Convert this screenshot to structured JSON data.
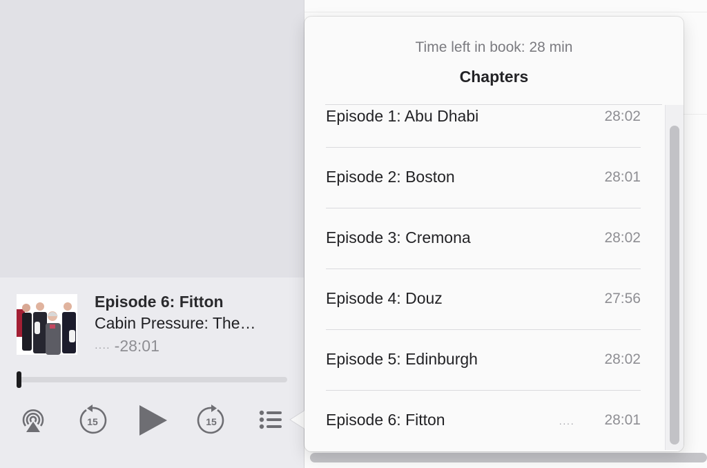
{
  "now_playing": {
    "title": "Episode 6: Fitton",
    "subtitle": "Cabin Pressure: The…",
    "remaining": "-28:01",
    "progress": 0.0
  },
  "controls": {
    "airplay_icon": "airplay-icon",
    "skip_back_seconds": "15",
    "play_icon": "play-icon",
    "skip_forward_seconds": "15",
    "chapters_icon": "list-icon"
  },
  "popover": {
    "time_left": "Time left in book: 28 min",
    "heading": "Chapters",
    "chapters": [
      {
        "title": "Episode 1: Abu Dhabi",
        "duration": "28:02"
      },
      {
        "title": "Episode 2: Boston",
        "duration": "28:01"
      },
      {
        "title": "Episode 3: Cremona",
        "duration": "28:02"
      },
      {
        "title": "Episode 4: Douz",
        "duration": "27:56"
      },
      {
        "title": "Episode 5: Edinburgh",
        "duration": "28:02"
      },
      {
        "title": "Episode 6: Fitton",
        "duration": "28:01",
        "playing": true
      }
    ]
  },
  "colors": {
    "accent": "#1c1c1e",
    "secondary_text": "#8e8e93"
  }
}
